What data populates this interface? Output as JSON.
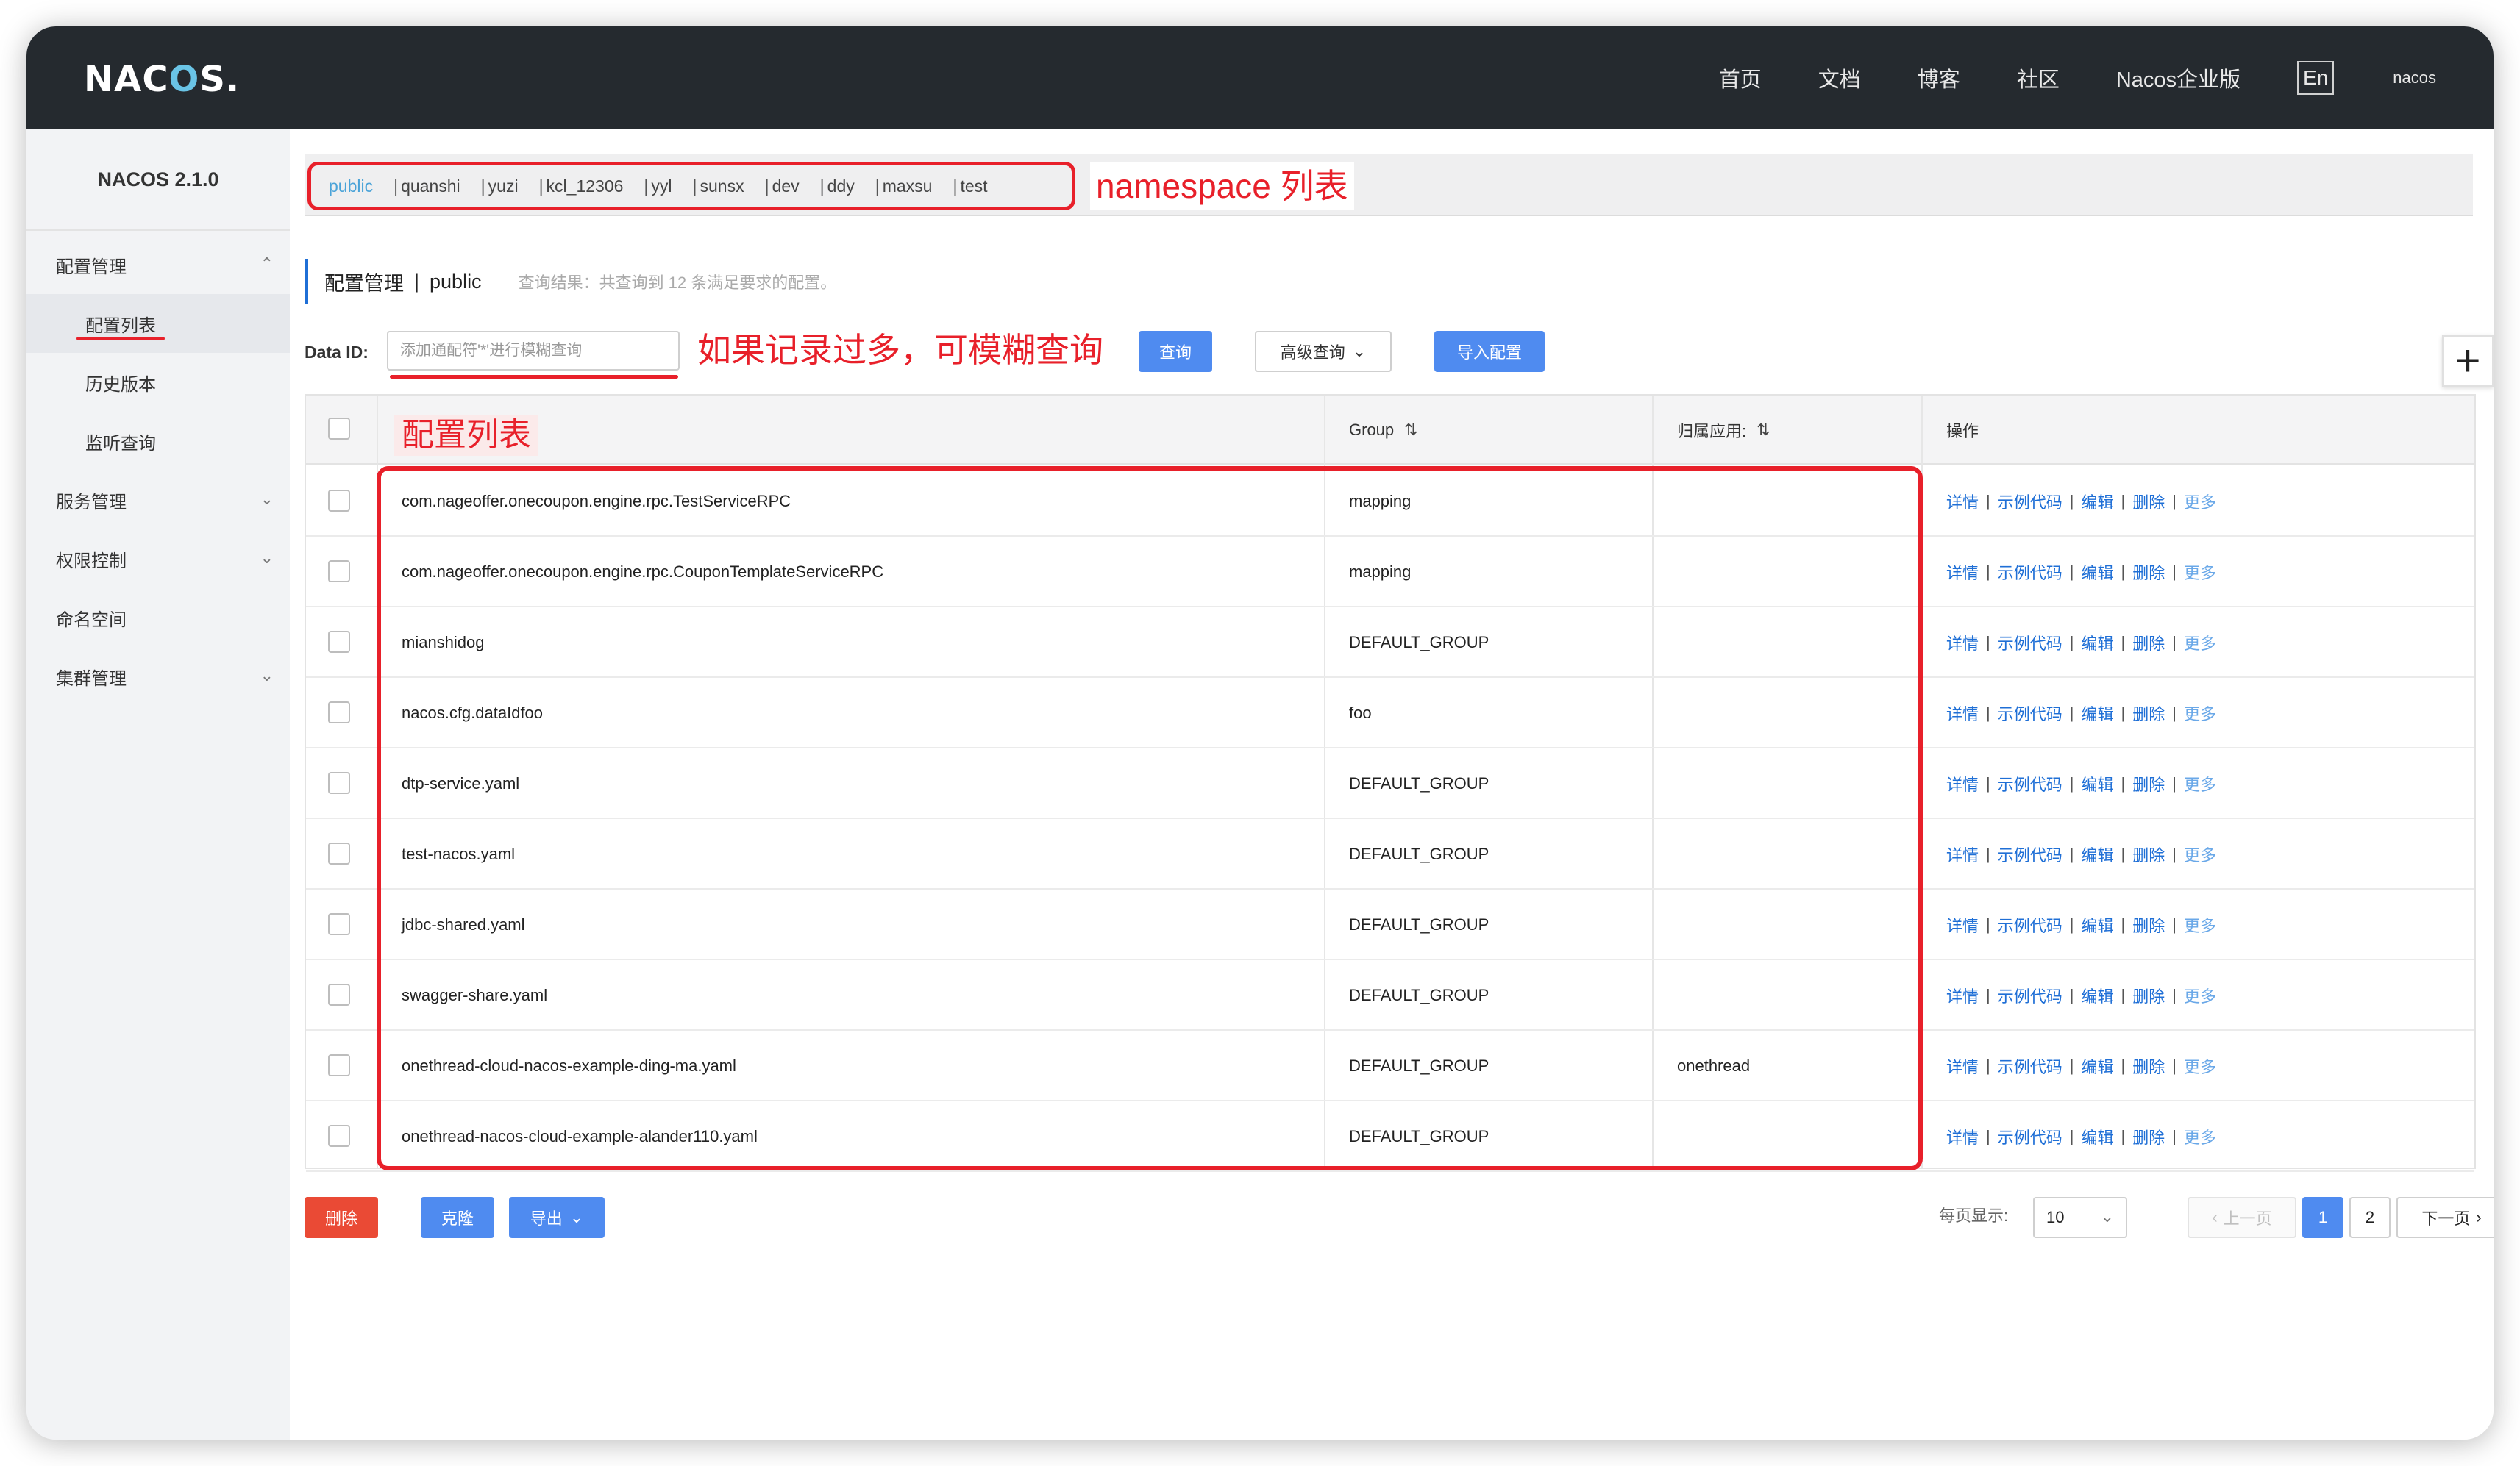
{
  "brand": {
    "logo_pre": "NAC",
    "logo_o": "O",
    "logo_post": "S."
  },
  "topnav": {
    "items": [
      "首页",
      "文档",
      "博客",
      "社区",
      "Nacos企业版"
    ],
    "lang_toggle": "En",
    "user": "nacos"
  },
  "sidebar": {
    "version": "NACOS 2.1.0",
    "groups": [
      {
        "label": "配置管理",
        "expanded": true
      },
      {
        "label": "服务管理"
      },
      {
        "label": "权限控制"
      },
      {
        "label": "命名空间"
      },
      {
        "label": "集群管理"
      }
    ],
    "config_sub": [
      "配置列表",
      "历史版本",
      "监听查询"
    ]
  },
  "namespaces": [
    "public",
    "quanshi",
    "yuzi",
    "kcl_12306",
    "yyl",
    "sunsx",
    "dev",
    "ddy",
    "maxsu",
    "test"
  ],
  "annotations": {
    "namespace": "namespace 列表",
    "search": "如果记录过多，可模糊查询",
    "list": "配置列表"
  },
  "breadcrumb": {
    "title": "配置管理",
    "separator": "|",
    "namespace": "public",
    "hint": "查询结果：共查询到 12 条满足要求的配置。"
  },
  "search": {
    "label": "Data ID:",
    "placeholder": "添加通配符'*'进行模糊查询",
    "query_btn": "查询",
    "advanced_btn": "高级查询",
    "import_btn": "导入配置"
  },
  "table": {
    "headers": {
      "group": "Group",
      "app": "归属应用:",
      "ops": "操作"
    },
    "ops_labels": [
      "详情",
      "示例代码",
      "编辑",
      "删除",
      "更多"
    ],
    "rows": [
      {
        "data_id": "com.nageoffer.onecoupon.engine.rpc.TestServiceRPC",
        "group": "mapping",
        "app": ""
      },
      {
        "data_id": "com.nageoffer.onecoupon.engine.rpc.CouponTemplateServiceRPC",
        "group": "mapping",
        "app": ""
      },
      {
        "data_id": "mianshidog",
        "group": "DEFAULT_GROUP",
        "app": ""
      },
      {
        "data_id": "nacos.cfg.dataIdfoo",
        "group": "foo",
        "app": ""
      },
      {
        "data_id": "dtp-service.yaml",
        "group": "DEFAULT_GROUP",
        "app": ""
      },
      {
        "data_id": "test-nacos.yaml",
        "group": "DEFAULT_GROUP",
        "app": ""
      },
      {
        "data_id": "jdbc-shared.yaml",
        "group": "DEFAULT_GROUP",
        "app": ""
      },
      {
        "data_id": "swagger-share.yaml",
        "group": "DEFAULT_GROUP",
        "app": ""
      },
      {
        "data_id": "onethread-cloud-nacos-example-ding-ma.yaml",
        "group": "DEFAULT_GROUP",
        "app": "onethread"
      },
      {
        "data_id": "onethread-nacos-cloud-example-alander110.yaml",
        "group": "DEFAULT_GROUP",
        "app": ""
      }
    ]
  },
  "footer": {
    "delete_btn": "删除",
    "clone_btn": "克隆",
    "export_btn": "导出",
    "page_size_label": "每页显示:",
    "page_size": "10",
    "prev": "上一页",
    "pages": [
      "1",
      "2"
    ],
    "current_page": "1",
    "next": "下一页"
  },
  "colors": {
    "topbar": "#252a2f",
    "primary": "#4f8bf0",
    "danger": "#ea4a35",
    "annotation": "#e8202a",
    "link": "#1f6fd6"
  }
}
